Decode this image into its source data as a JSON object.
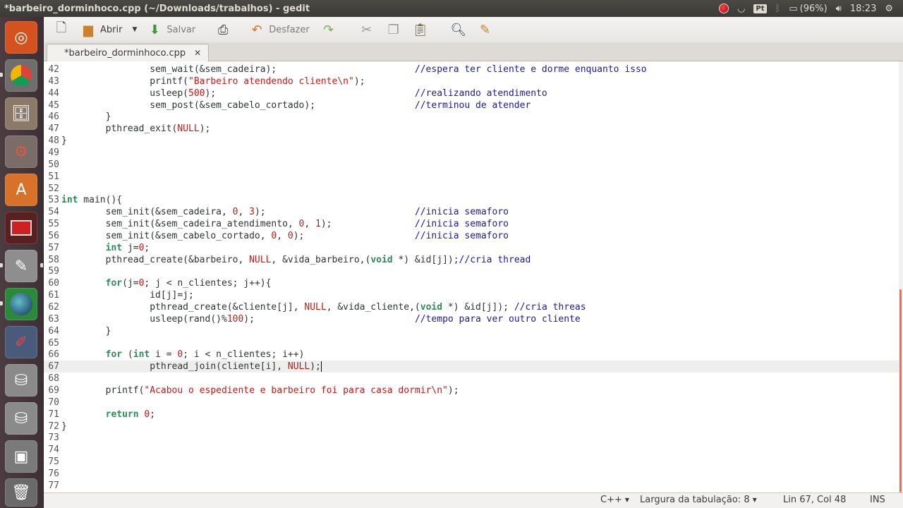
{
  "window": {
    "title": "*barbeiro_dorminhoco.cpp (~/Downloads/trabalhos) - gedit"
  },
  "indicators": {
    "keyboard": "Pt",
    "battery": "(96%)",
    "clock": "18:23"
  },
  "launcher": {
    "items": [
      {
        "name": "ubuntu-dash",
        "icon": "ubuntu-logo-icon"
      },
      {
        "name": "chrome",
        "icon": "chrome-icon"
      },
      {
        "name": "files",
        "icon": "file-cabinet-icon"
      },
      {
        "name": "system-settings",
        "icon": "gear-wrench-icon"
      },
      {
        "name": "software-center",
        "icon": "shopping-bag-icon"
      },
      {
        "name": "terminal-app",
        "icon": "red-window-icon"
      },
      {
        "name": "gedit",
        "icon": "text-editor-icon"
      },
      {
        "name": "globe-app",
        "icon": "globe-icon"
      },
      {
        "name": "drawing-app",
        "icon": "paint-icon"
      },
      {
        "name": "drive-1",
        "icon": "drive-icon"
      },
      {
        "name": "drive-2",
        "icon": "drive-icon"
      },
      {
        "name": "media-player",
        "icon": "media-player-icon"
      },
      {
        "name": "trash",
        "icon": "trash-icon"
      }
    ]
  },
  "toolbar": {
    "open_label": "Abrir",
    "save_label": "Salvar",
    "undo_label": "Desfazer"
  },
  "tabs": [
    {
      "label": "*barbeiro_dorminhoco.cpp",
      "close_glyph": "✕"
    }
  ],
  "editor": {
    "current_line": 67,
    "lines": [
      {
        "n": "42",
        "code": "                sem_wait(&sem_cadeira);                         //espera ter cliente e dorme enquanto isso"
      },
      {
        "n": "43",
        "code": "                printf(\"Barbeiro atendendo cliente\\n\");"
      },
      {
        "n": "44",
        "code": "                usleep(500);                                    //realizando atendimento"
      },
      {
        "n": "45",
        "code": "                sem_post(&sem_cabelo_cortado);                  //terminou de atender"
      },
      {
        "n": "46",
        "code": "        }"
      },
      {
        "n": "47",
        "code": "        pthread_exit(NULL);"
      },
      {
        "n": "48",
        "code": "}"
      },
      {
        "n": "49",
        "code": ""
      },
      {
        "n": "50",
        "code": ""
      },
      {
        "n": "51",
        "code": ""
      },
      {
        "n": "52",
        "code": ""
      },
      {
        "n": "53",
        "code": "int main(){"
      },
      {
        "n": "54",
        "code": "        sem_init(&sem_cadeira, 0, 3);                           //inicia semaforo"
      },
      {
        "n": "55",
        "code": "        sem_init(&sem_cadeira_atendimento, 0, 1);               //inicia semaforo"
      },
      {
        "n": "56",
        "code": "        sem_init(&sem_cabelo_cortado, 0, 0);                    //inicia semaforo"
      },
      {
        "n": "57",
        "code": "        int j=0;"
      },
      {
        "n": "58",
        "code": "        pthread_create(&barbeiro, NULL, &vida_barbeiro,(void *) &id[j]);//cria thread"
      },
      {
        "n": "59",
        "code": ""
      },
      {
        "n": "60",
        "code": "        for(j=0; j < n_clientes; j++){"
      },
      {
        "n": "61",
        "code": "                id[j]=j;"
      },
      {
        "n": "62",
        "code": "                pthread_create(&cliente[j], NULL, &vida_cliente,(void *) &id[j]); //cria threas"
      },
      {
        "n": "63",
        "code": "                usleep(rand()%100);                             //tempo para ver outro cliente"
      },
      {
        "n": "64",
        "code": "        }"
      },
      {
        "n": "65",
        "code": ""
      },
      {
        "n": "66",
        "code": "        for (int i = 0; i < n_clientes; i++)"
      },
      {
        "n": "67",
        "code": "                pthread_join(cliente[i], NULL);"
      },
      {
        "n": "68",
        "code": ""
      },
      {
        "n": "69",
        "code": "        printf(\"Acabou o espediente e barbeiro foi para casa dormir\\n\");"
      },
      {
        "n": "70",
        "code": ""
      },
      {
        "n": "71",
        "code": "        return 0;"
      },
      {
        "n": "72",
        "code": "}"
      },
      {
        "n": "73",
        "code": ""
      },
      {
        "n": "74",
        "code": ""
      },
      {
        "n": "75",
        "code": ""
      },
      {
        "n": "76",
        "code": ""
      },
      {
        "n": "77",
        "code": ""
      }
    ]
  },
  "statusbar": {
    "language": "C++",
    "tab_width": "Largura da tabulação: 8",
    "position": "Lin 67, Col 48",
    "mode": "INS"
  },
  "colors": {
    "keyword": "#2e8b57",
    "string": "#c41a16",
    "comment": "#1a1aa6",
    "scroll_thumb": "#e8734a"
  }
}
